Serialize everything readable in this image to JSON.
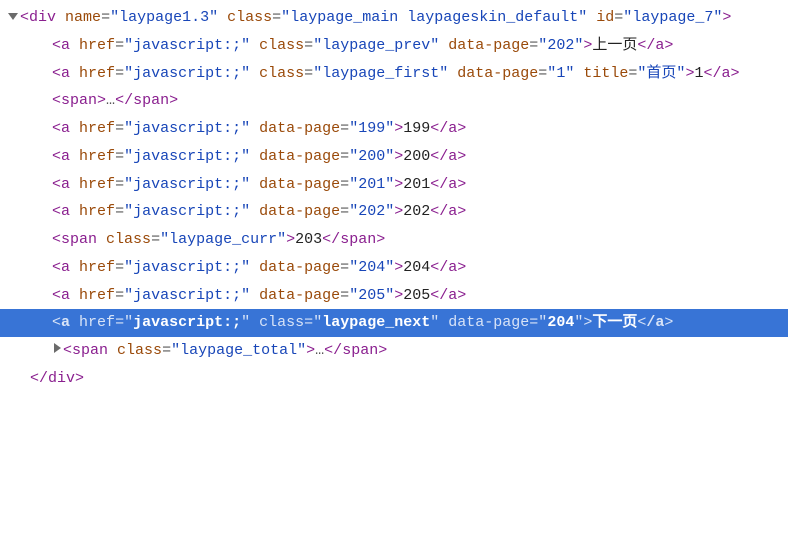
{
  "root": {
    "tag": "div",
    "attrs": {
      "name": "laypage1.3",
      "class": "laypage_main laypageskin_default",
      "id": "laypage_7"
    }
  },
  "prev": {
    "tag": "a",
    "href": "javascript:;",
    "class": "laypage_prev",
    "data_page": "202",
    "text": "上一页"
  },
  "first": {
    "tag": "a",
    "href": "javascript:;",
    "class": "laypage_first",
    "data_page": "1",
    "title": "首页",
    "text": "1"
  },
  "ellipsis1": {
    "tag": "span",
    "content": "…"
  },
  "pages": [
    {
      "tag": "a",
      "href": "javascript:;",
      "data_page": "199",
      "text": "199"
    },
    {
      "tag": "a",
      "href": "javascript:;",
      "data_page": "200",
      "text": "200"
    },
    {
      "tag": "a",
      "href": "javascript:;",
      "data_page": "201",
      "text": "201"
    },
    {
      "tag": "a",
      "href": "javascript:;",
      "data_page": "202",
      "text": "202"
    }
  ],
  "curr": {
    "tag": "span",
    "class": "laypage_curr",
    "text": "203"
  },
  "pages_after": [
    {
      "tag": "a",
      "href": "javascript:;",
      "data_page": "204",
      "text": "204"
    },
    {
      "tag": "a",
      "href": "javascript:;",
      "data_page": "205",
      "text": "205"
    }
  ],
  "next": {
    "tag": "a",
    "href": "javascript:;",
    "class": "laypage_next",
    "data_page": "204",
    "text": "下一页"
  },
  "total": {
    "tag": "span",
    "class": "laypage_total",
    "content": "…"
  },
  "close_root": "div"
}
